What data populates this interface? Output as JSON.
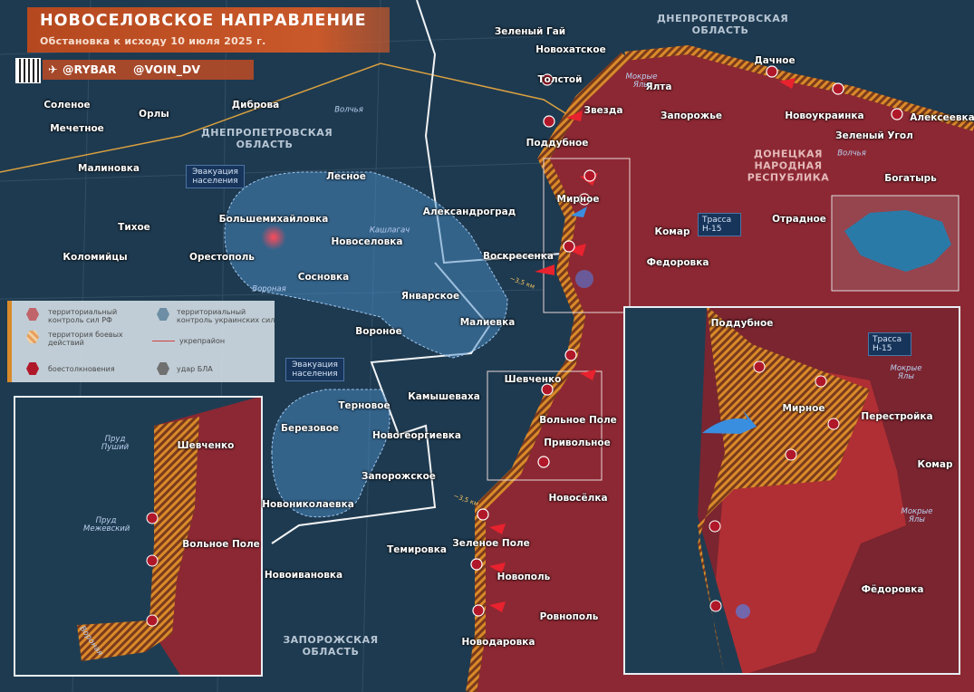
{
  "header": {
    "title": "НОВОСЕЛОВСКОЕ НАПРАВЛЕНИЕ",
    "subtitle": "Обстановка к исходу 10 июля 2025 г.",
    "telegram_handle": "@RYBAR",
    "second_handle": "@VOIN_DV"
  },
  "legend": {
    "rf_control": "территориальный контроль сил РФ",
    "ua_control": "территориальный контроль украинских сил",
    "combat_zone": "территория боевых действий",
    "fortified_area": "укрепрайон",
    "clashes": "боестолкновения",
    "drone_strike": "удар БЛА"
  },
  "colors": {
    "rf_territory": "#8c2833",
    "contested": "#d98a2a",
    "ua_territory": "#1e3a50",
    "evacuation_zone": "#4a8cc4",
    "header": "#c0502a"
  },
  "regions": [
    "ДНЕПРОПЕТРОВСКАЯ ОБЛАСТЬ",
    "ДНЕПРОПЕТРОВСКАЯ ОБЛАСТЬ",
    "ДОНЕЦКАЯ НАРОДНАЯ РЕСПУБЛИКА",
    "ЗАПОРОЖСКАЯ ОБЛАСТЬ"
  ],
  "settlements": [
    "Зеленый Гай",
    "Новохатское",
    "Толстой",
    "Звезда",
    "Ялта",
    "Запорожье",
    "Дачное",
    "Новоукраинка",
    "Алексеевка",
    "Зеленый Угол",
    "Богатырь",
    "Поддубное",
    "Мирное",
    "Комар",
    "Отрадное",
    "Федоровка",
    "Александроград",
    "Воскресенка",
    "Лесное",
    "Большемихайловка",
    "Новоселовка",
    "Орестополь",
    "Январское",
    "Сосновка",
    "Малиевка",
    "Вороное",
    "Соленое",
    "Мечетное",
    "Орлы",
    "Диброва",
    "Малиновка",
    "Тихое",
    "Коломийцы",
    "Терновое",
    "Камышеваха",
    "Березовое",
    "Новогеоргиевка",
    "Запорожское",
    "Новониколаевка",
    "Шевченко",
    "Вольное Поле",
    "Привольное",
    "Новосёлка",
    "Зеленое Поле",
    "Темировка",
    "Новоивановка",
    "Новополь",
    "Ровнополь",
    "Новодаровка"
  ],
  "rivers": [
    "Мокрые Ялы",
    "Волчья",
    "Волчья",
    "Вороная",
    "Кашлагач"
  ],
  "callouts": {
    "evacuation": "Эвакуация населения",
    "highway": "Трасса Н-15",
    "distance": "~3,5 км"
  },
  "inset_right": {
    "settlements": [
      "Поддубное",
      "Мирное",
      "Перестройка",
      "Комар",
      "Фёдоровка"
    ],
    "rivers": [
      "Мокрые Ялы",
      "Мокрые Ялы"
    ],
    "highway": "Трасса Н-15"
  },
  "inset_left": {
    "settlements": [
      "Шевченко",
      "Вольное Поле"
    ],
    "water": [
      "Пруд Пуший",
      "Пруд Межевский",
      "Вороная"
    ]
  }
}
